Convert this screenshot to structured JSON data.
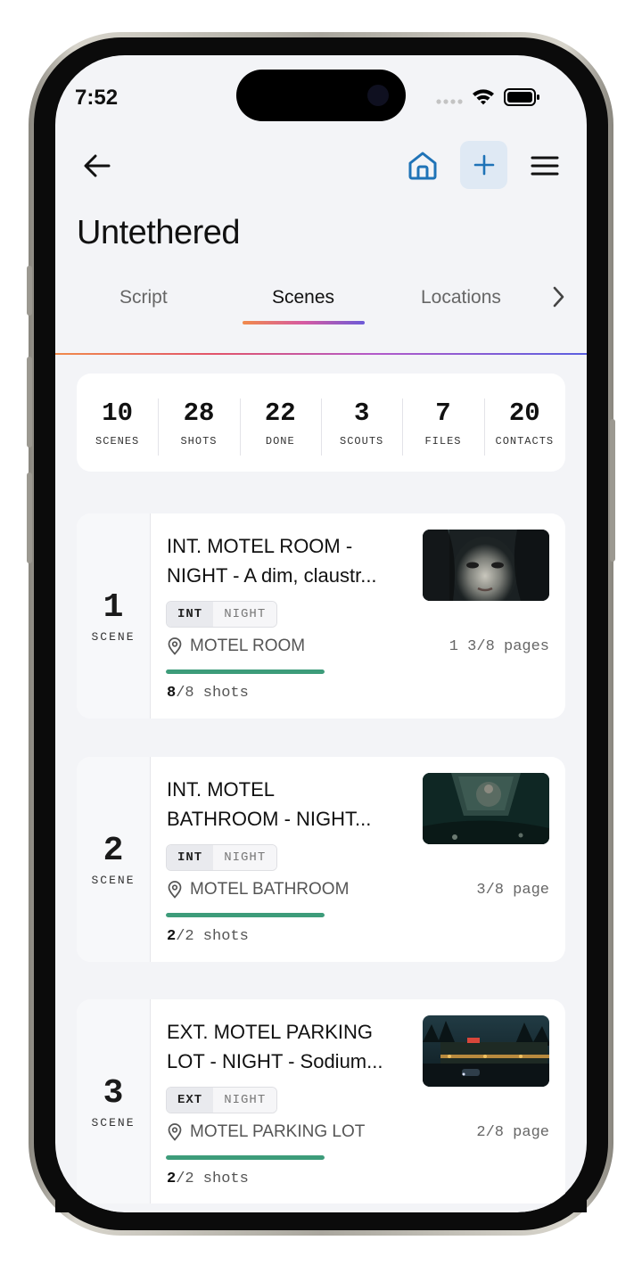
{
  "status_bar": {
    "time": "7:52"
  },
  "app": {
    "title": "Untethered"
  },
  "tabs": [
    {
      "label": "Script",
      "active": false
    },
    {
      "label": "Scenes",
      "active": true
    },
    {
      "label": "Locations",
      "active": false
    }
  ],
  "stats": [
    {
      "value": "10",
      "label": "SCENES"
    },
    {
      "value": "28",
      "label": "SHOTS"
    },
    {
      "value": "22",
      "label": "DONE"
    },
    {
      "value": "3",
      "label": "SCOUTS"
    },
    {
      "value": "7",
      "label": "FILES"
    },
    {
      "value": "20",
      "label": "CONTACTS"
    }
  ],
  "scenes": [
    {
      "number": "1",
      "scene_word": "SCENE",
      "title_line1": "INT. MOTEL ROOM -",
      "title_line2": "NIGHT - A dim, claustr...",
      "int_ext": "INT",
      "time_of_day": "NIGHT",
      "location": "MOTEL ROOM",
      "pages": "1 3/8 pages",
      "shots_done": "8",
      "shots_rest": "/8 shots",
      "progress": 1.0
    },
    {
      "number": "2",
      "scene_word": "SCENE",
      "title_line1": "INT. MOTEL",
      "title_line2": "BATHROOM - NIGHT...",
      "int_ext": "INT",
      "time_of_day": "NIGHT",
      "location": "MOTEL BATHROOM",
      "pages": "3/8 page",
      "shots_done": "2",
      "shots_rest": "/2 shots",
      "progress": 1.0
    },
    {
      "number": "3",
      "scene_word": "SCENE",
      "title_line1": "EXT. MOTEL PARKING",
      "title_line2": "LOT - NIGHT - Sodium...",
      "int_ext": "EXT",
      "time_of_day": "NIGHT",
      "location": "MOTEL PARKING LOT",
      "pages": "2/8 page",
      "shots_done": "2",
      "shots_rest": "/2 shots",
      "progress": 1.0
    }
  ],
  "colors": {
    "accent_blue": "#1f73b7",
    "progress_green": "#3d9c7a",
    "tab_gradient": [
      "#f08a4b",
      "#d65aa2",
      "#6c5ad8"
    ]
  },
  "icons": {
    "back": "arrow-left-icon",
    "home": "home-icon",
    "add": "plus-icon",
    "menu": "hamburger-menu-icon",
    "tabs_more": "chevron-right-icon",
    "location": "map-pin-icon"
  }
}
